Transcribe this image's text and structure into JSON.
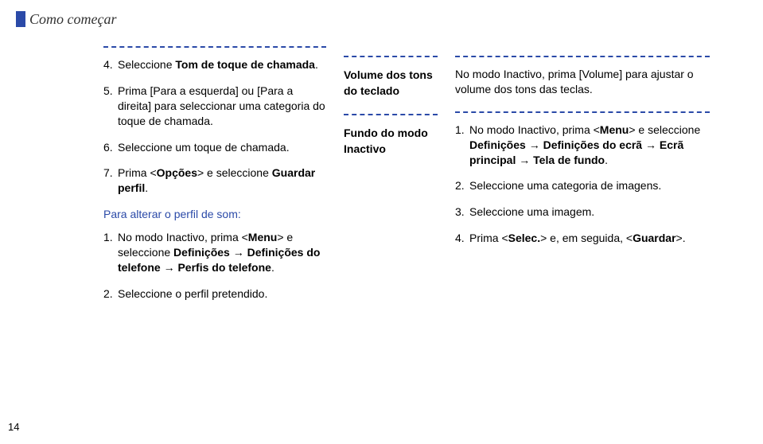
{
  "header": {
    "title": "Como começar"
  },
  "page_number": "14",
  "left": {
    "step4_num": "4.",
    "step4_text_pre": "Seleccione ",
    "step4_bold": "Tom de toque de chamada",
    "step4_text_post": ".",
    "step5_num": "5.",
    "step5_text": "Prima [Para a esquerda] ou [Para a direita] para seleccionar uma categoria do toque de chamada.",
    "step6_num": "6.",
    "step6_text": "Seleccione um toque de chamada.",
    "step7_num": "7.",
    "step7_text_pre": "Prima <",
    "step7_bold1": "Opções",
    "step7_text_mid": "> e seleccione ",
    "step7_bold2": "Guardar perfil",
    "step7_text_post": ".",
    "subheading": "Para alterar o perfil de som:",
    "sub1_num": "1.",
    "sub1_text_pre": "No modo Inactivo, prima <",
    "sub1_bold1": "Menu",
    "sub1_text_mid": "> e seleccione ",
    "sub1_bold2": "Definições",
    "sub1_arrow1": " → ",
    "sub1_bold3": "Definições do telefone",
    "sub1_arrow2": " → ",
    "sub1_bold4": "Perfis do telefone",
    "sub1_text_post": ".",
    "sub2_num": "2.",
    "sub2_text": "Seleccione o perfil pretendido."
  },
  "mid": {
    "label1": "Volume dos tons do teclado",
    "label2": "Fundo do modo Inactivo"
  },
  "right": {
    "top_text": "No modo Inactivo, prima [Volume] para ajustar o volume dos tons das teclas.",
    "r1_num": "1.",
    "r1_pre": "No modo Inactivo, prima <",
    "r1_bold1": "Menu",
    "r1_mid": "> e seleccione ",
    "r1_bold2": "Definições",
    "r1_arrow1": " → ",
    "r1_bold3": "Definições do ecrã",
    "r1_arrow2": " → ",
    "r1_bold4": "Ecrã principal",
    "r1_arrow3": " → ",
    "r1_bold5": "Tela de fundo",
    "r1_post": ".",
    "r2_num": "2.",
    "r2_text": "Seleccione uma categoria de imagens.",
    "r3_num": "3.",
    "r3_text": "Seleccione uma imagem.",
    "r4_num": "4.",
    "r4_pre": "Prima <",
    "r4_bold1": "Selec.",
    "r4_mid": "> e, em seguida, <",
    "r4_bold2": "Guardar",
    "r4_post": ">."
  }
}
